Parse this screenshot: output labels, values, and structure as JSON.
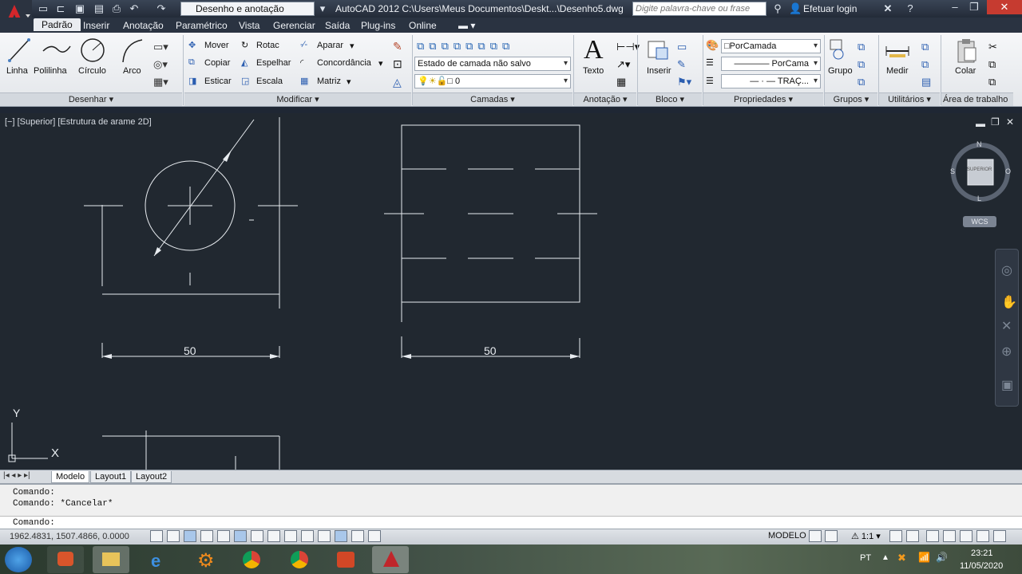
{
  "titlebar": {
    "workspace": "Desenho e anotação",
    "app_title": "AutoCAD 2012    C:\\Users\\Meus Documentos\\Deskt...\\Desenho5.dwg",
    "search_placeholder": "Digite palavra-chave ou frase",
    "login": "Efetuar login"
  },
  "tabs": [
    "Padrão",
    "Inserir",
    "Anotação",
    "Paramétrico",
    "Vista",
    "Gerenciar",
    "Saída",
    "Plug-ins",
    "Online"
  ],
  "ribbon": {
    "desenhar": {
      "title": "Desenhar",
      "tools": [
        "Linha",
        "Polilinha",
        "Círculo",
        "Arco"
      ]
    },
    "modificar": {
      "title": "Modificar",
      "tools": [
        "Mover",
        "Rotac",
        "Aparar",
        "Copiar",
        "Espelhar",
        "Concordância",
        "Esticar",
        "Escala",
        "Matriz"
      ]
    },
    "camadas": {
      "title": "Camadas",
      "state": "Estado de camada não salvo",
      "layer": "0"
    },
    "anotacao": {
      "title": "Anotação",
      "texto": "Texto"
    },
    "bloco": {
      "title": "Bloco",
      "inserir": "Inserir"
    },
    "propriedades": {
      "title": "Propriedades",
      "color": "PorCamada",
      "lineweight": "PorCama",
      "linetype": "TRAÇ..."
    },
    "grupos": {
      "title": "Grupos",
      "grupo": "Grupo"
    },
    "utilitarios": {
      "title": "Utilitários",
      "medir": "Medir"
    },
    "area": {
      "title": "Área de trabalho",
      "colar": "Colar"
    }
  },
  "viewport_label": "[−] [Superior] [Estrutura de arame 2D]",
  "viewcube": {
    "n": "N",
    "s": "S",
    "o": "O",
    "l": "L",
    "center": "SUPERIOR",
    "wcs": "WCS"
  },
  "drawing": {
    "dim_left": "50",
    "dim_right": "50",
    "ucs_y": "Y",
    "ucs_x": "X"
  },
  "layout_tabs": [
    "Modelo",
    "Layout1",
    "Layout2"
  ],
  "command": {
    "line1": "Comando:",
    "line2": "Comando: *Cancelar*",
    "prompt": "Comando:"
  },
  "status": {
    "coords": "1962.4831, 1507.4866, 0.0000",
    "modelo": "MODELO",
    "scale": "1:1"
  },
  "taskbar": {
    "lang": "PT",
    "time": "23:21",
    "date": "11/05/2020"
  },
  "colors": {
    "canvas": "#212830",
    "accent": "#c0262b"
  }
}
